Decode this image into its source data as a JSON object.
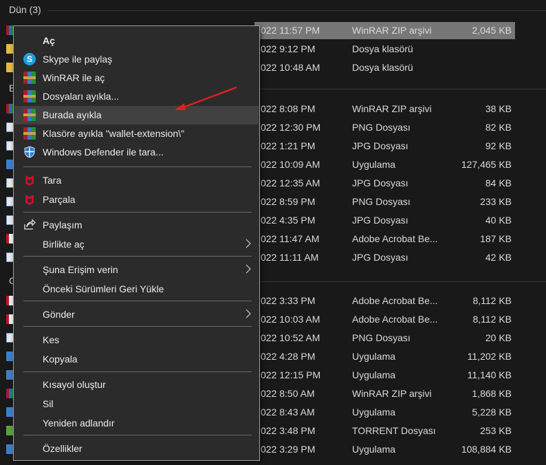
{
  "groups": {
    "yesterday": "Dün (3)",
    "earlier_partial": "B",
    "other_partial": "G"
  },
  "rows": [
    {
      "icon": "rar",
      "date": "022 11:57 PM",
      "type": "WinRAR ZIP arşivi",
      "size": "2,045 KB",
      "selected": true
    },
    {
      "icon": "folder",
      "date": "022 9:12 PM",
      "type": "Dosya klasörü",
      "size": ""
    },
    {
      "icon": "folder",
      "date": "022 10:48 AM",
      "type": "Dosya klasörü",
      "size": ""
    },
    {
      "icon": "rar",
      "date": "022 8:08 PM",
      "type": "WinRAR ZIP arşivi",
      "size": "38 KB"
    },
    {
      "icon": "img",
      "date": "022 12:30 PM",
      "type": "PNG Dosyası",
      "size": "82 KB"
    },
    {
      "icon": "img",
      "date": "022 1:21 PM",
      "type": "JPG Dosyası",
      "size": "92 KB"
    },
    {
      "icon": "app",
      "date": "022 10:09 AM",
      "type": "Uygulama",
      "size": "127,465 KB"
    },
    {
      "icon": "img",
      "date": "022 12:35 AM",
      "type": "JPG Dosyası",
      "size": "84 KB"
    },
    {
      "icon": "img",
      "date": "022 8:59 PM",
      "type": "PNG Dosyası",
      "size": "233 KB"
    },
    {
      "icon": "img",
      "date": "022 4:35 PM",
      "type": "JPG Dosyası",
      "size": "40 KB"
    },
    {
      "icon": "pdf",
      "date": "022 11:47 AM",
      "type": "Adobe Acrobat Be...",
      "size": "187 KB"
    },
    {
      "icon": "img",
      "date": "022 11:11 AM",
      "type": "JPG Dosyası",
      "size": "42 KB"
    },
    {
      "icon": "pdf",
      "date": "022 3:33 PM",
      "type": "Adobe Acrobat Be...",
      "size": "8,112 KB"
    },
    {
      "icon": "pdf",
      "date": "022 10:03 AM",
      "type": "Adobe Acrobat Be...",
      "size": "8,112 KB"
    },
    {
      "icon": "img",
      "date": "022 10:52 AM",
      "type": "PNG Dosyası",
      "size": "20 KB"
    },
    {
      "icon": "app",
      "date": "022 4:28 PM",
      "type": "Uygulama",
      "size": "11,202 KB"
    },
    {
      "icon": "app",
      "date": "022 12:15 PM",
      "type": "Uygulama",
      "size": "11,140 KB"
    },
    {
      "icon": "rar",
      "date": "022 8:50 AM",
      "type": "WinRAR ZIP arşivi",
      "size": "1,868 KB"
    },
    {
      "icon": "app",
      "date": "022 8:43 AM",
      "type": "Uygulama",
      "size": "5,228 KB"
    },
    {
      "icon": "torrent",
      "date": "022 3:48 PM",
      "type": "TORRENT Dosyası",
      "size": "253 KB"
    },
    {
      "icon": "app",
      "date": "022 3:29 PM",
      "type": "Uygulama",
      "size": "108,884 KB"
    }
  ],
  "menu": {
    "open": "Aç",
    "skype": "Skype ile paylaş",
    "winrar_open": "WinRAR ile aç",
    "extract_files": "Dosyaları ayıkla...",
    "extract_here": "Burada ayıkla",
    "extract_to": "Klasöre ayıkla \"wallet-extension\\\"",
    "defender": "Windows Defender ile tara...",
    "scan": "Tara",
    "shred": "Parçala",
    "share": "Paylaşım",
    "open_with": "Birlikte aç",
    "give_access": "Şuna Erişim verin",
    "restore": "Önceki Sürümleri Geri Yükle",
    "send_to": "Gönder",
    "cut": "Kes",
    "copy": "Kopyala",
    "shortcut": "Kısayol oluştur",
    "delete": "Sil",
    "rename": "Yeniden adlandır",
    "properties": "Özellikler"
  },
  "colors": {
    "annotation_arrow": "#e02020",
    "selection": "#777777",
    "menu_bg": "#2b2b2b"
  },
  "icons": {
    "skype": "skype-icon",
    "winrar": "winrar-icon",
    "defender": "windows-defender-icon",
    "mcafee": "mcafee-icon",
    "share": "share-icon",
    "submenu": "chevron-right-icon"
  }
}
